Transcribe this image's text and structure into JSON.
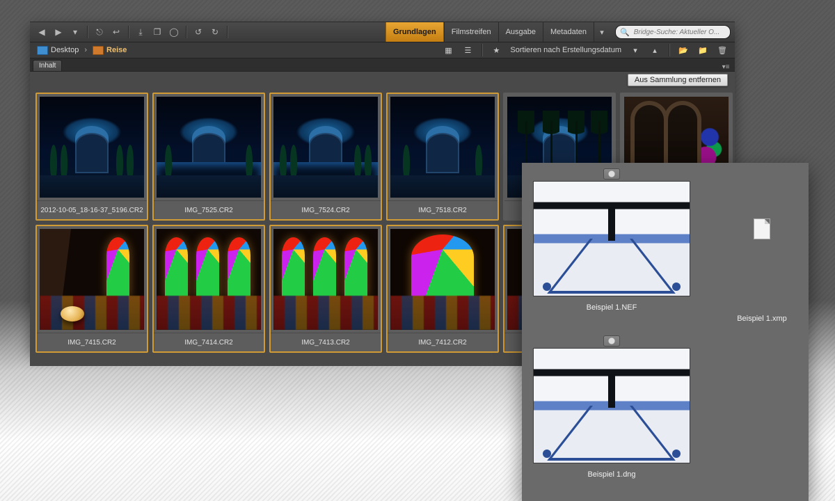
{
  "workspaces": {
    "grundlagen": "Grundlagen",
    "filmstreifen": "Filmstreifen",
    "ausgabe": "Ausgabe",
    "metadaten": "Metadaten"
  },
  "search": {
    "placeholder": "Bridge-Suche: Aktueller O..."
  },
  "breadcrumb": {
    "desktop": "Desktop",
    "reise": "Reise"
  },
  "sort": {
    "label": "Sortieren nach Erstellungsdatum"
  },
  "panel": {
    "tab_inhalt": "Inhalt"
  },
  "buttons": {
    "remove_from_collection": "Aus Sammlung entfernen"
  },
  "thumbs": {
    "t1": "2012-10-05_18-16-37_5196.CR2",
    "t2": "IMG_7525.CR2",
    "t3": "IMG_7524.CR2",
    "t4": "IMG_7518.CR2",
    "t7": "IMG_7415.CR2",
    "t8": "IMG_7414.CR2",
    "t9": "IMG_7413.CR2",
    "t10": "IMG_7412.CR2"
  },
  "overlay": {
    "nef": "Beispiel 1.NEF",
    "xmp": "Beispiel 1.xmp",
    "dng": "Beispiel 1.dng"
  }
}
